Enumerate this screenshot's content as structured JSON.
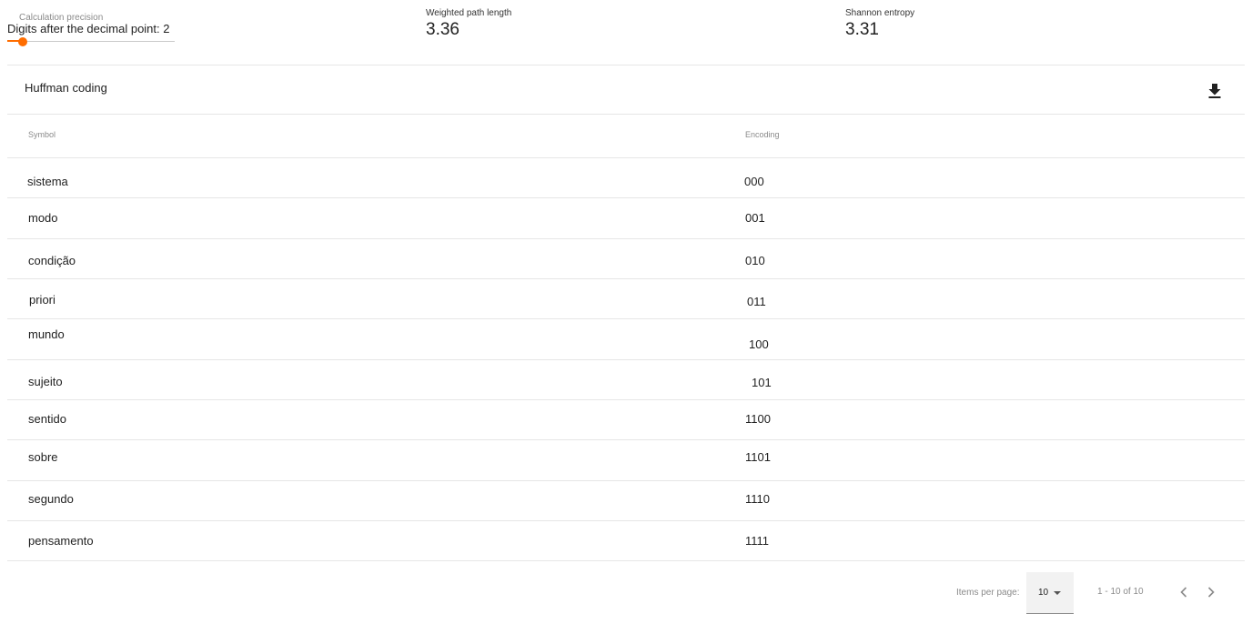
{
  "precision": {
    "label": "Calculation precision",
    "value_text": "Digits after the decimal point: 2",
    "value": 2
  },
  "stats": {
    "weighted_path_length": {
      "label": "Weighted path length",
      "value": "3.36"
    },
    "shannon_entropy": {
      "label": "Shannon entropy",
      "value": "3.31"
    }
  },
  "card": {
    "title": "Huffman coding",
    "download_icon": "download-icon"
  },
  "table": {
    "headers": {
      "symbol": "Symbol",
      "encoding": "Encoding"
    },
    "rows": [
      {
        "symbol": "sistema",
        "encoding": "000"
      },
      {
        "symbol": "modo",
        "encoding": "001"
      },
      {
        "symbol": "condição",
        "encoding": "010"
      },
      {
        "symbol": "priori",
        "encoding": "011"
      },
      {
        "symbol": "mundo",
        "encoding": "100"
      },
      {
        "symbol": "sujeito",
        "encoding": "101"
      },
      {
        "symbol": "sentido",
        "encoding": "1100"
      },
      {
        "symbol": "sobre",
        "encoding": "1101"
      },
      {
        "symbol": "segundo",
        "encoding": "1110"
      },
      {
        "symbol": "pensamento",
        "encoding": "1111"
      }
    ]
  },
  "paginator": {
    "items_per_page_label": "Items per page:",
    "page_size": "10",
    "range_label": "1 - 10 of 10",
    "prev_icon": "chevron-left-icon",
    "next_icon": "chevron-right-icon"
  },
  "colors": {
    "accent": "#ff6d00",
    "divider": "#e6e6e6",
    "muted_text": "#8a8a8a"
  }
}
